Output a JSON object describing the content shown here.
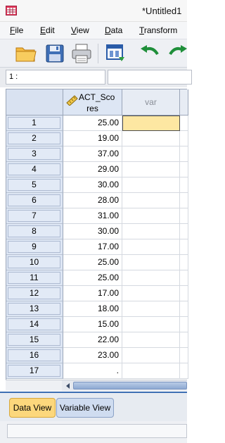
{
  "window": {
    "title": "*Untitled1",
    "app_icon": "spss-grid-icon"
  },
  "menu": {
    "items": [
      {
        "label": "File",
        "mnemonic": "F",
        "rest": "ile"
      },
      {
        "label": "Edit",
        "mnemonic": "E",
        "rest": "dit"
      },
      {
        "label": "View",
        "mnemonic": "V",
        "rest": "iew"
      },
      {
        "label": "Data",
        "mnemonic": "D",
        "rest": "ata"
      },
      {
        "label": "Transform",
        "mnemonic": "T",
        "rest": "ransform"
      }
    ]
  },
  "toolbar": {
    "buttons": [
      {
        "name": "open-folder-icon"
      },
      {
        "name": "save-disk-icon"
      },
      {
        "name": "print-icon"
      },
      {
        "name": "dialog-recall-icon"
      },
      {
        "name": "undo-icon"
      },
      {
        "name": "redo-icon"
      }
    ]
  },
  "cell_editor": {
    "reference": "1 :",
    "value": ""
  },
  "grid": {
    "columns": [
      {
        "name": "ACT_Scores",
        "label_top": "ACT_Sco",
        "label_bottom": "res",
        "type_icon": "scale-ruler-icon"
      },
      {
        "name": "var",
        "label_top": "var",
        "label_bottom": ""
      }
    ],
    "rows": [
      {
        "n": "1",
        "value": "25.00"
      },
      {
        "n": "2",
        "value": "19.00"
      },
      {
        "n": "3",
        "value": "37.00"
      },
      {
        "n": "4",
        "value": "29.00"
      },
      {
        "n": "5",
        "value": "30.00"
      },
      {
        "n": "6",
        "value": "28.00"
      },
      {
        "n": "7",
        "value": "31.00"
      },
      {
        "n": "8",
        "value": "30.00"
      },
      {
        "n": "9",
        "value": "17.00"
      },
      {
        "n": "10",
        "value": "25.00"
      },
      {
        "n": "11",
        "value": "25.00"
      },
      {
        "n": "12",
        "value": "17.00"
      },
      {
        "n": "13",
        "value": "18.00"
      },
      {
        "n": "14",
        "value": "15.00"
      },
      {
        "n": "15",
        "value": "22.00"
      },
      {
        "n": "16",
        "value": "23.00"
      },
      {
        "n": "17",
        "value": "."
      }
    ],
    "selected": {
      "row": "1",
      "column": "var"
    }
  },
  "tabs": [
    {
      "label": "Data View",
      "active": true
    },
    {
      "label": "Variable View",
      "active": false
    }
  ],
  "status": {
    "text": ""
  },
  "colors": {
    "selected_cell": "#fde7a2",
    "active_tab": "#fcd77c",
    "header_bg": "#dde6f4"
  }
}
